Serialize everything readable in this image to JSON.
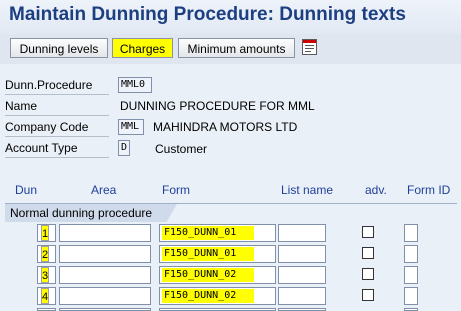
{
  "window": {
    "title": "Maintain Dunning Procedure: Dunning texts"
  },
  "toolbar": {
    "dunning_levels_label": "Dunning levels",
    "charges_label": "Charges",
    "minimum_amounts_label": "Minimum amounts",
    "highlight_color": "#ffff00"
  },
  "header": {
    "dunn_procedure_label": "Dunn.Procedure",
    "dunn_procedure_value": "MML0",
    "name_label": "Name",
    "name_value": "DUNNING PROCEDURE FOR MML",
    "company_code_label": "Company Code",
    "company_code_value": "MML",
    "company_name": "MAHINDRA MOTORS LTD",
    "account_type_label": "Account Type",
    "account_type_value": "D",
    "account_type_text": "Customer"
  },
  "table": {
    "columns": {
      "dun": "Dun",
      "area": "Area",
      "form": "Form",
      "list_name": "List name",
      "adv": "adv.",
      "form_id": "Form ID"
    },
    "group_label": "Normal dunning procedure",
    "rows": [
      {
        "dun": "1",
        "form": "F150_DUNN_01",
        "adv": false
      },
      {
        "dun": "2",
        "form": "F150_DUNN_01",
        "adv": false
      },
      {
        "dun": "3",
        "form": "F150_DUNN_02",
        "adv": false
      },
      {
        "dun": "4",
        "form": "F150_DUNN_02",
        "adv": false
      }
    ]
  }
}
